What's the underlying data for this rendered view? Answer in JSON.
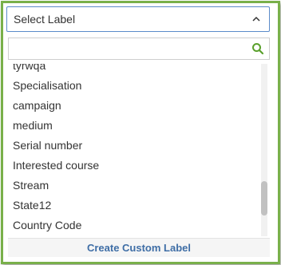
{
  "select": {
    "label": "Select Label",
    "chevron_icon": "chevron-up-icon"
  },
  "search": {
    "value": "",
    "placeholder": "",
    "icon": "search-icon",
    "icon_color": "#5aa02c"
  },
  "labels": [
    "tyrwqa",
    "Specialisation",
    "campaign",
    "medium",
    "Serial number",
    "Interested course",
    "Stream",
    "State12",
    "Country Code"
  ],
  "scroll": {
    "position": 0.85,
    "visible_fraction": 0.2
  },
  "footer": {
    "create_label": "Create Custom Label"
  },
  "colors": {
    "frame_border": "#79b04a",
    "select_border": "#5b8bc9",
    "link": "#3f6ea6"
  }
}
